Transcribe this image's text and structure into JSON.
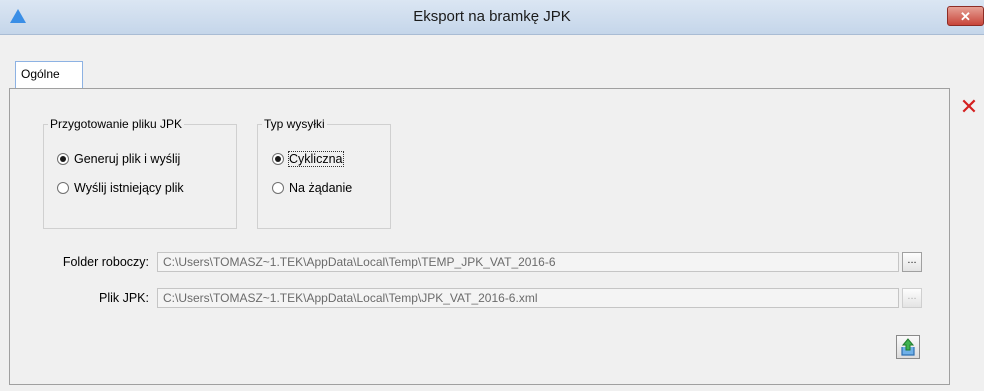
{
  "window": {
    "title": "Eksport na bramkę JPK",
    "close_label": "✕"
  },
  "tabs": [
    {
      "label": "Ogólne"
    }
  ],
  "group_prep": {
    "title": "Przygotowanie pliku JPK",
    "options": [
      {
        "label": "Generuj plik i wyślij",
        "selected": true
      },
      {
        "label": "Wyślij istniejący plik",
        "selected": false
      }
    ]
  },
  "group_type": {
    "title": "Typ wysyłki",
    "options": [
      {
        "label": "Cykliczna",
        "selected": true
      },
      {
        "label": "Na żądanie",
        "selected": false
      }
    ]
  },
  "fields": {
    "folder_label": "Folder roboczy:",
    "folder_value": "C:\\Users\\TOMASZ~1.TEK\\AppData\\Local\\Temp\\TEMP_JPK_VAT_2016-6",
    "file_label": "Plik JPK:",
    "file_value": "C:\\Users\\TOMASZ~1.TEK\\AppData\\Local\\Temp\\JPK_VAT_2016-6.xml",
    "browse_label": "..."
  },
  "icons": {
    "sidebar_close": "close-icon",
    "export": "export-icon"
  },
  "colors": {
    "accent": "#3a8ee6",
    "close_red": "#d42020"
  }
}
